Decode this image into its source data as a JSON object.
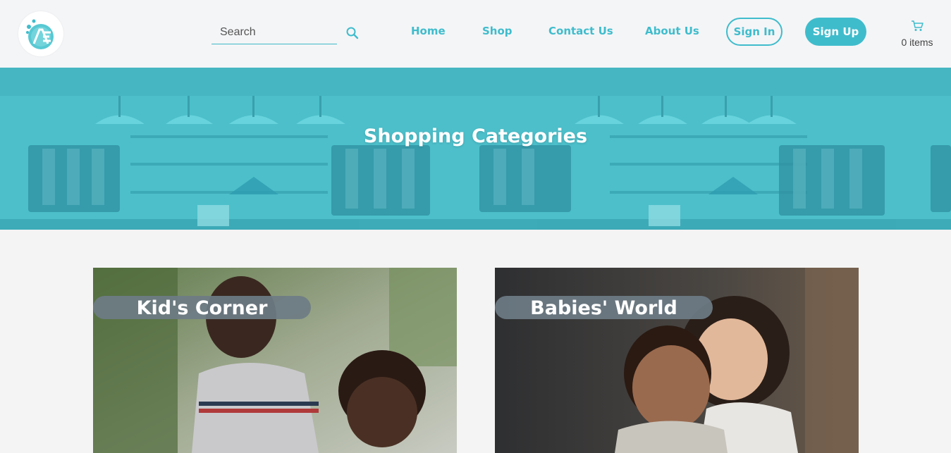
{
  "header": {
    "logo_alt": "logo",
    "search": {
      "placeholder": "Search",
      "value": ""
    },
    "nav": [
      {
        "label": "Home"
      },
      {
        "label": "Shop"
      },
      {
        "label": "Contact Us"
      },
      {
        "label": "About Us"
      }
    ],
    "sign_in_label": "Sign In",
    "sign_up_label": "Sign Up",
    "cart": {
      "count_text": "0 items",
      "icon": "cart-icon"
    }
  },
  "hero": {
    "title": "Shopping Categories"
  },
  "categories": [
    {
      "label": "Kid's Corner"
    },
    {
      "label": "Babies' World"
    }
  ],
  "colors": {
    "accent": "#3fbccc",
    "label_bg": "#6e7c86",
    "page_bg": "#f4f4f4"
  }
}
